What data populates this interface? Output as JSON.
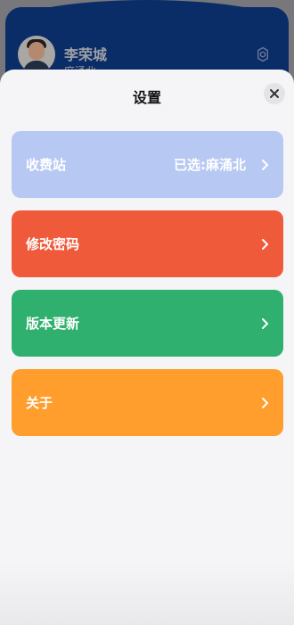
{
  "background": {
    "user": {
      "name": "李荣城",
      "station": "麻涌北"
    }
  },
  "sheet": {
    "title": "设置",
    "items": [
      {
        "label": "收费站",
        "value": "已选:麻涌北",
        "color": "#b7c8f3"
      },
      {
        "label": "修改密码",
        "value": "",
        "color": "#ef5a3b"
      },
      {
        "label": "版本更新",
        "value": "",
        "color": "#2fb06e"
      },
      {
        "label": "关于",
        "value": "",
        "color": "#ff9d2d"
      }
    ]
  },
  "icons": {
    "close": "close-icon",
    "chevron": "chevron-right-icon",
    "settings": "gear-icon"
  }
}
